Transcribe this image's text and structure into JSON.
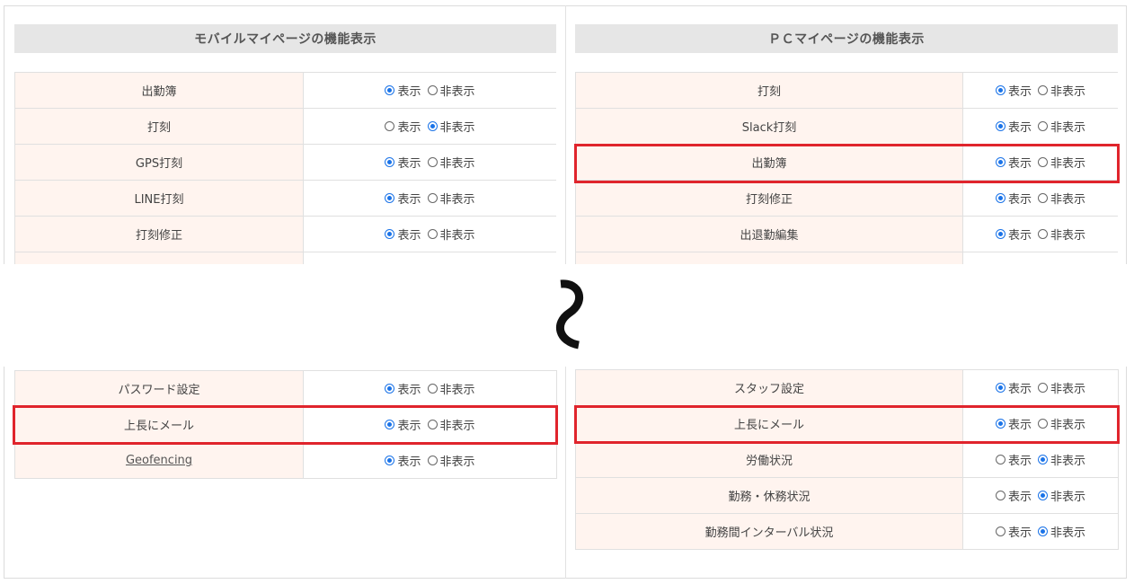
{
  "mobile": {
    "title": "モバイルマイページの機能表示",
    "rows_top": [
      {
        "label": "出勤簿",
        "show": true
      },
      {
        "label": "打刻",
        "show": false
      },
      {
        "label": "GPS打刻",
        "show": true
      },
      {
        "label": "LINE打刻",
        "show": true
      },
      {
        "label": "打刻修正",
        "show": true
      }
    ],
    "rows_bottom": [
      {
        "label": "パスワード設定",
        "show": true
      },
      {
        "label": "上長にメール",
        "show": true
      },
      {
        "label": "Geofencing",
        "show": true
      }
    ]
  },
  "pc": {
    "title": "ＰＣマイページの機能表示",
    "rows_top": [
      {
        "label": "打刻",
        "show": true
      },
      {
        "label": "Slack打刻",
        "show": true
      },
      {
        "label": "出勤簿",
        "show": true
      },
      {
        "label": "打刻修正",
        "show": true
      },
      {
        "label": "出退勤編集",
        "show": true
      }
    ],
    "rows_bottom": [
      {
        "label": "スタッフ設定",
        "show": true
      },
      {
        "label": "上長にメール",
        "show": true
      },
      {
        "label": "労働状況",
        "show": false
      },
      {
        "label": "勤務・休務状況",
        "show": false
      },
      {
        "label": "勤務間インターバル状況",
        "show": false
      }
    ]
  },
  "options": {
    "show_label": "表示",
    "hide_label": "非表示"
  },
  "colors": {
    "highlight": "#e0242c",
    "label_bg": "#fff4ef",
    "header_bg": "#e6e6e6",
    "radio_accent": "#1a73e8"
  }
}
